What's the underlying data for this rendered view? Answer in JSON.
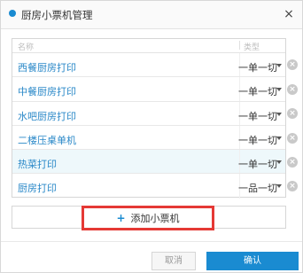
{
  "dialog": {
    "title": "厨房小票机管理",
    "close_glyph": "×"
  },
  "list": {
    "header_name": "名称",
    "header_type": "类型",
    "rows": [
      {
        "name": "西餐厨房打印",
        "type": "一单一切",
        "selected": false
      },
      {
        "name": "中餐厨房打印",
        "type": "一单一切",
        "selected": false
      },
      {
        "name": "水吧厨房打印",
        "type": "一单一切",
        "selected": false
      },
      {
        "name": "二楼压桌单机",
        "type": "一单一切",
        "selected": false
      },
      {
        "name": "热菜打印",
        "type": "一单一切",
        "selected": true
      },
      {
        "name": "厨房打印",
        "type": "一品一切",
        "selected": false
      }
    ]
  },
  "add_button": {
    "icon": "plus-icon",
    "label": "添加小票机"
  },
  "footer": {
    "cancel_label": "取消",
    "confirm_label": "确认"
  },
  "colors": {
    "accent": "#1a8bd1",
    "highlight_border": "#e53935",
    "selected_row_bg": "#eef8fb"
  }
}
